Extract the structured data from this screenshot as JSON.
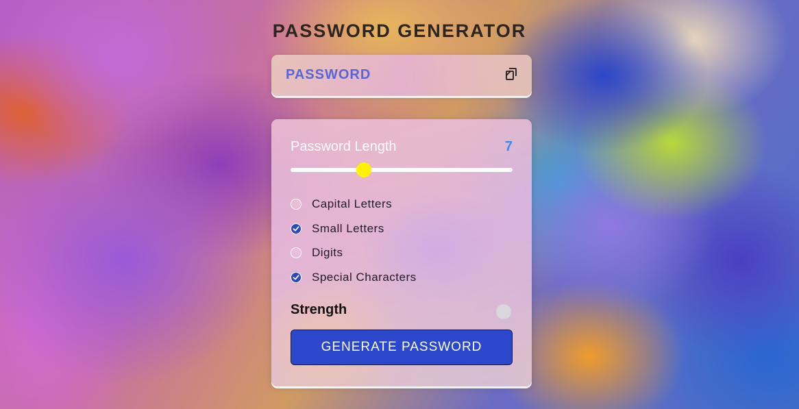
{
  "app": {
    "title": "PASSWORD GENERATOR"
  },
  "password": {
    "value": "PASSWORD",
    "copy_icon": "copy-icon"
  },
  "length": {
    "label": "Password Length",
    "value": "7",
    "slider_fraction": 0.33
  },
  "options": [
    {
      "label": "Capital Letters",
      "checked": false
    },
    {
      "label": "Small Letters",
      "checked": true
    },
    {
      "label": "Digits",
      "checked": false
    },
    {
      "label": "Special Characters",
      "checked": true
    }
  ],
  "strength": {
    "label": "Strength",
    "indicator_color": "#d9d6dc"
  },
  "generate": {
    "label": "GENERATE PASSWORD"
  },
  "colors": {
    "accent": "#2b47cc",
    "thumb": "#fff200",
    "length_value": "#3d8be8",
    "password_text": "#5a63d8"
  }
}
